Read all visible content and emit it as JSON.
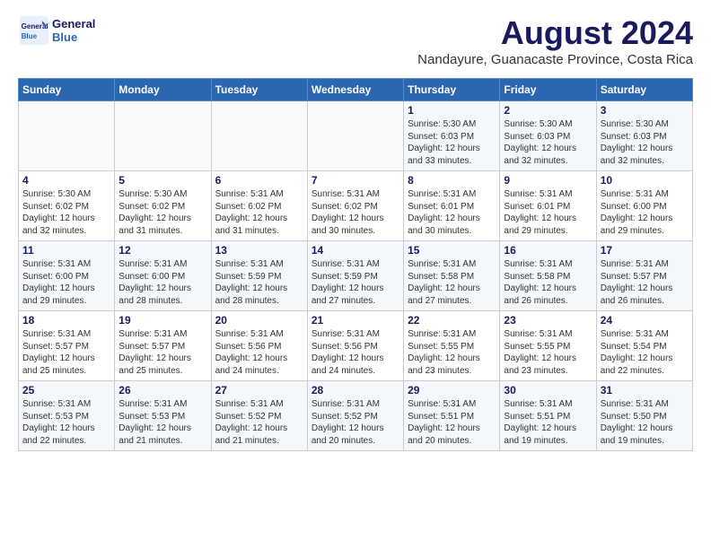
{
  "header": {
    "month_title": "August 2024",
    "location": "Nandayure, Guanacaste Province, Costa Rica",
    "logo_line1": "General",
    "logo_line2": "Blue"
  },
  "weekdays": [
    "Sunday",
    "Monday",
    "Tuesday",
    "Wednesday",
    "Thursday",
    "Friday",
    "Saturday"
  ],
  "weeks": [
    [
      {
        "day": "",
        "info": ""
      },
      {
        "day": "",
        "info": ""
      },
      {
        "day": "",
        "info": ""
      },
      {
        "day": "",
        "info": ""
      },
      {
        "day": "1",
        "info": "Sunrise: 5:30 AM\nSunset: 6:03 PM\nDaylight: 12 hours\nand 33 minutes."
      },
      {
        "day": "2",
        "info": "Sunrise: 5:30 AM\nSunset: 6:03 PM\nDaylight: 12 hours\nand 32 minutes."
      },
      {
        "day": "3",
        "info": "Sunrise: 5:30 AM\nSunset: 6:03 PM\nDaylight: 12 hours\nand 32 minutes."
      }
    ],
    [
      {
        "day": "4",
        "info": "Sunrise: 5:30 AM\nSunset: 6:02 PM\nDaylight: 12 hours\nand 32 minutes."
      },
      {
        "day": "5",
        "info": "Sunrise: 5:30 AM\nSunset: 6:02 PM\nDaylight: 12 hours\nand 31 minutes."
      },
      {
        "day": "6",
        "info": "Sunrise: 5:31 AM\nSunset: 6:02 PM\nDaylight: 12 hours\nand 31 minutes."
      },
      {
        "day": "7",
        "info": "Sunrise: 5:31 AM\nSunset: 6:02 PM\nDaylight: 12 hours\nand 30 minutes."
      },
      {
        "day": "8",
        "info": "Sunrise: 5:31 AM\nSunset: 6:01 PM\nDaylight: 12 hours\nand 30 minutes."
      },
      {
        "day": "9",
        "info": "Sunrise: 5:31 AM\nSunset: 6:01 PM\nDaylight: 12 hours\nand 29 minutes."
      },
      {
        "day": "10",
        "info": "Sunrise: 5:31 AM\nSunset: 6:00 PM\nDaylight: 12 hours\nand 29 minutes."
      }
    ],
    [
      {
        "day": "11",
        "info": "Sunrise: 5:31 AM\nSunset: 6:00 PM\nDaylight: 12 hours\nand 29 minutes."
      },
      {
        "day": "12",
        "info": "Sunrise: 5:31 AM\nSunset: 6:00 PM\nDaylight: 12 hours\nand 28 minutes."
      },
      {
        "day": "13",
        "info": "Sunrise: 5:31 AM\nSunset: 5:59 PM\nDaylight: 12 hours\nand 28 minutes."
      },
      {
        "day": "14",
        "info": "Sunrise: 5:31 AM\nSunset: 5:59 PM\nDaylight: 12 hours\nand 27 minutes."
      },
      {
        "day": "15",
        "info": "Sunrise: 5:31 AM\nSunset: 5:58 PM\nDaylight: 12 hours\nand 27 minutes."
      },
      {
        "day": "16",
        "info": "Sunrise: 5:31 AM\nSunset: 5:58 PM\nDaylight: 12 hours\nand 26 minutes."
      },
      {
        "day": "17",
        "info": "Sunrise: 5:31 AM\nSunset: 5:57 PM\nDaylight: 12 hours\nand 26 minutes."
      }
    ],
    [
      {
        "day": "18",
        "info": "Sunrise: 5:31 AM\nSunset: 5:57 PM\nDaylight: 12 hours\nand 25 minutes."
      },
      {
        "day": "19",
        "info": "Sunrise: 5:31 AM\nSunset: 5:57 PM\nDaylight: 12 hours\nand 25 minutes."
      },
      {
        "day": "20",
        "info": "Sunrise: 5:31 AM\nSunset: 5:56 PM\nDaylight: 12 hours\nand 24 minutes."
      },
      {
        "day": "21",
        "info": "Sunrise: 5:31 AM\nSunset: 5:56 PM\nDaylight: 12 hours\nand 24 minutes."
      },
      {
        "day": "22",
        "info": "Sunrise: 5:31 AM\nSunset: 5:55 PM\nDaylight: 12 hours\nand 23 minutes."
      },
      {
        "day": "23",
        "info": "Sunrise: 5:31 AM\nSunset: 5:55 PM\nDaylight: 12 hours\nand 23 minutes."
      },
      {
        "day": "24",
        "info": "Sunrise: 5:31 AM\nSunset: 5:54 PM\nDaylight: 12 hours\nand 22 minutes."
      }
    ],
    [
      {
        "day": "25",
        "info": "Sunrise: 5:31 AM\nSunset: 5:53 PM\nDaylight: 12 hours\nand 22 minutes."
      },
      {
        "day": "26",
        "info": "Sunrise: 5:31 AM\nSunset: 5:53 PM\nDaylight: 12 hours\nand 21 minutes."
      },
      {
        "day": "27",
        "info": "Sunrise: 5:31 AM\nSunset: 5:52 PM\nDaylight: 12 hours\nand 21 minutes."
      },
      {
        "day": "28",
        "info": "Sunrise: 5:31 AM\nSunset: 5:52 PM\nDaylight: 12 hours\nand 20 minutes."
      },
      {
        "day": "29",
        "info": "Sunrise: 5:31 AM\nSunset: 5:51 PM\nDaylight: 12 hours\nand 20 minutes."
      },
      {
        "day": "30",
        "info": "Sunrise: 5:31 AM\nSunset: 5:51 PM\nDaylight: 12 hours\nand 19 minutes."
      },
      {
        "day": "31",
        "info": "Sunrise: 5:31 AM\nSunset: 5:50 PM\nDaylight: 12 hours\nand 19 minutes."
      }
    ]
  ]
}
